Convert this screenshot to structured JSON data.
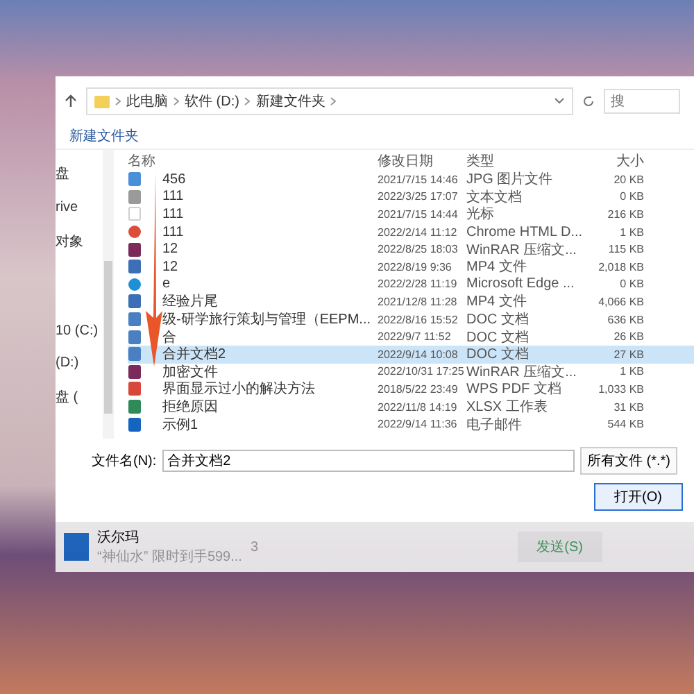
{
  "breadcrumb": [
    "此电脑",
    "软件 (D:)",
    "新建文件夹"
  ],
  "search": {
    "placeholder": "搜"
  },
  "toolbar": {
    "new_folder": "新建文件夹"
  },
  "sidebar": {
    "items": [
      "盘",
      "rive",
      "对象",
      "10 (C:)",
      "(D:)",
      "盘 ("
    ]
  },
  "table": {
    "columns": [
      "名称",
      "修改日期",
      "类型",
      "大小"
    ],
    "rows": [
      {
        "kind": "image",
        "name": "456",
        "date": "2021/7/15 14:46",
        "type": "JPG 图片文件",
        "size": "20 KB",
        "selected": false
      },
      {
        "kind": "text",
        "name": "111",
        "date": "2022/3/25 17:07",
        "type": "文本文档",
        "size": "0 KB",
        "selected": false
      },
      {
        "kind": "blank",
        "name": "111",
        "date": "2021/7/15 14:44",
        "type": "光标",
        "size": "216 KB",
        "selected": false
      },
      {
        "kind": "chrome",
        "name": "111",
        "date": "2022/2/14 11:12",
        "type": "Chrome HTML D...",
        "size": "1 KB",
        "selected": false
      },
      {
        "kind": "rar",
        "name": "12",
        "date": "2022/8/25 18:03",
        "type": "WinRAR 压缩文...",
        "size": "115 KB",
        "selected": false
      },
      {
        "kind": "video",
        "name": "12",
        "date": "2022/8/19 9:36",
        "type": "MP4 文件",
        "size": "2,018 KB",
        "selected": false
      },
      {
        "kind": "edge",
        "name": "e",
        "date": "2022/2/28 11:19",
        "type": "Microsoft Edge ...",
        "size": "0 KB",
        "selected": false
      },
      {
        "kind": "video",
        "name": "经验片尾",
        "date": "2021/12/8 11:28",
        "type": "MP4 文件",
        "size": "4,066 KB",
        "selected": false
      },
      {
        "kind": "doc",
        "name": "级-研学旅行策划与管理（EEPM...",
        "date": "2022/8/16 15:52",
        "type": "DOC 文档",
        "size": "636 KB",
        "selected": false
      },
      {
        "kind": "doc",
        "name": "合",
        "date": "2022/9/7 11:52",
        "type": "DOC 文档",
        "size": "26 KB",
        "selected": false
      },
      {
        "kind": "doc",
        "name": "合并文档2",
        "date": "2022/9/14 10:08",
        "type": "DOC 文档",
        "size": "27 KB",
        "selected": true
      },
      {
        "kind": "rar",
        "name": "加密文件",
        "date": "2022/10/31 17:25",
        "type": "WinRAR 压缩文...",
        "size": "1 KB",
        "selected": false
      },
      {
        "kind": "pdf",
        "name": "界面显示过小的解决方法",
        "date": "2018/5/22 23:49",
        "type": "WPS PDF 文档",
        "size": "1,033 KB",
        "selected": false
      },
      {
        "kind": "xlsx",
        "name": "拒绝原因",
        "date": "2022/11/8 14:19",
        "type": "XLSX 工作表",
        "size": "31 KB",
        "selected": false
      },
      {
        "kind": "mail",
        "name": "示例1",
        "date": "2022/9/14 11:36",
        "type": "电子邮件",
        "size": "544 KB",
        "selected": false
      }
    ]
  },
  "filename": {
    "label": "文件名(N):",
    "value": "合并文档2"
  },
  "filter": "所有文件 (*.*)",
  "open_button": "打开(O)",
  "chat": {
    "title": "沃尔玛",
    "preview": "“神仙水” 限时到手599...",
    "count": "3",
    "send_button": "发送(S)"
  }
}
